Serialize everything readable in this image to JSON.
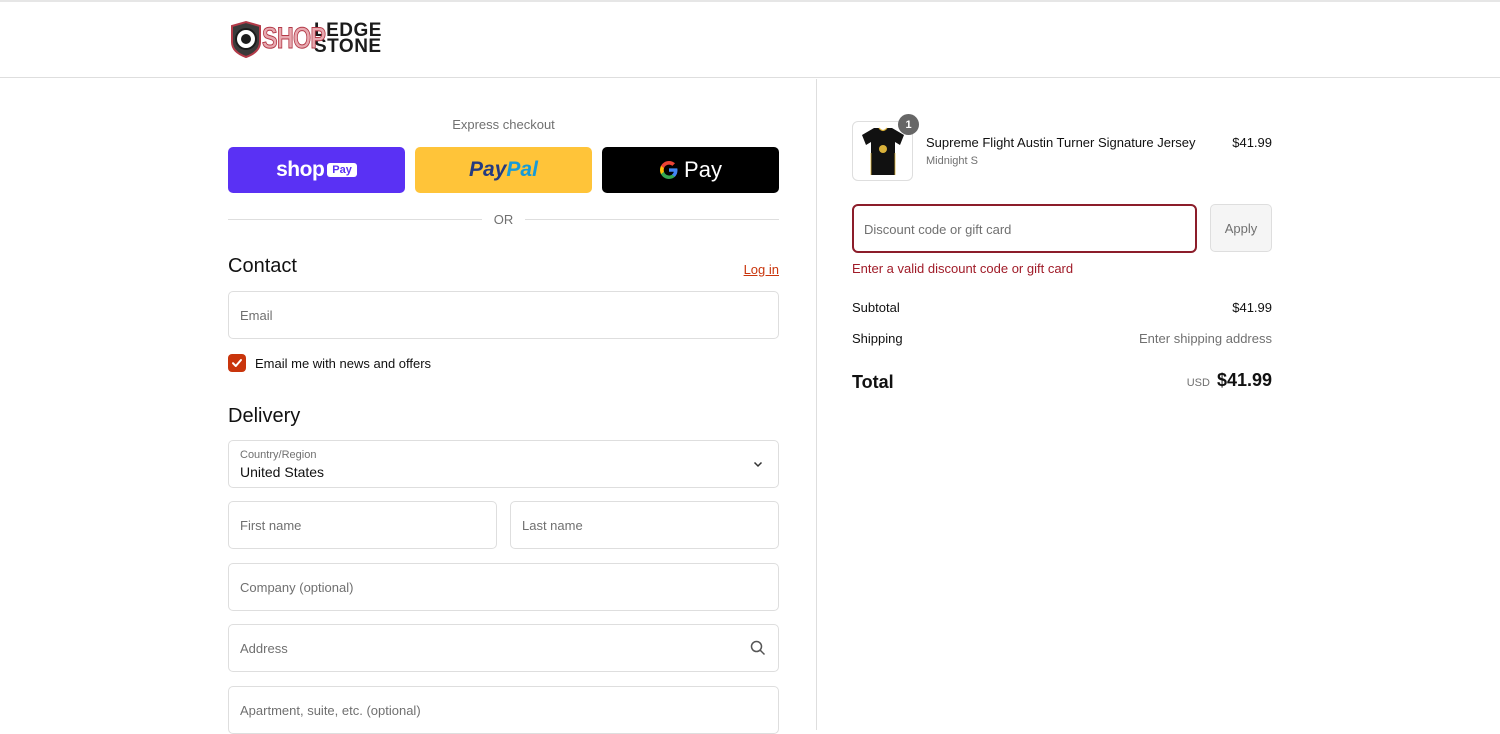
{
  "brand": {
    "logo_shop": "SHOP",
    "logo_line1": "LEDGE",
    "logo_line2": "STONE"
  },
  "express": {
    "title": "Express checkout",
    "shop_label": "shop",
    "shop_pay_badge": "Pay",
    "paypal_label_1": "Pay",
    "paypal_label_2": "Pal",
    "gpay_g": "G",
    "gpay_label": "Pay",
    "or_label": "OR"
  },
  "contact": {
    "title": "Contact",
    "login_label": "Log in",
    "email_placeholder": "Email",
    "newsletter_label": "Email me with news and offers",
    "newsletter_checked": true
  },
  "delivery": {
    "title": "Delivery",
    "country_label": "Country/Region",
    "country_value": "United States",
    "first_name_placeholder": "First name",
    "last_name_placeholder": "Last name",
    "company_placeholder": "Company (optional)",
    "address_placeholder": "Address",
    "apartment_placeholder": "Apartment, suite, etc. (optional)"
  },
  "order": {
    "item": {
      "name": "Supreme Flight Austin Turner Signature Jersey",
      "variant": "Midnight S",
      "price": "$41.99",
      "quantity": "1"
    },
    "discount_placeholder": "Discount code or gift card",
    "apply_label": "Apply",
    "discount_error": "Enter a valid discount code or gift card",
    "subtotal_label": "Subtotal",
    "subtotal_value": "$41.99",
    "shipping_label": "Shipping",
    "shipping_value": "Enter shipping address",
    "total_label": "Total",
    "total_currency": "USD",
    "total_value": "$41.99"
  },
  "colors": {
    "accent": "#c9350c",
    "error": "#a01b28",
    "shop_pay": "#5a31f4",
    "paypal": "#ffc439",
    "gpay": "#000000"
  }
}
